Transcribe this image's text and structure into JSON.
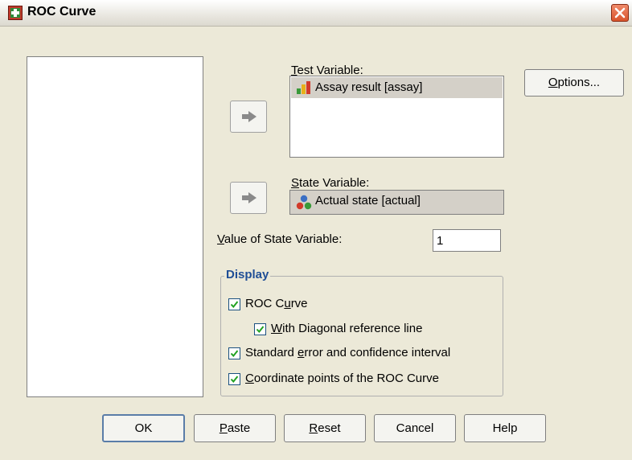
{
  "window": {
    "title": "ROC Curve"
  },
  "test_variable": {
    "label_accesskey": "T",
    "label_rest": "est Variable:",
    "item": "Assay result [assay]"
  },
  "state_variable": {
    "label_accesskey": "S",
    "label_rest": "tate Variable:",
    "item": "Actual state [actual]"
  },
  "value_of_state": {
    "label_accesskey": "V",
    "label_rest": "alue of State Variable:",
    "value": "1"
  },
  "options_button": {
    "accesskey": "O",
    "rest": "ptions..."
  },
  "display": {
    "legend": "Display",
    "roc_curve": {
      "before": "ROC C",
      "accesskey": "u",
      "after": "rve",
      "checked": true
    },
    "diagonal": {
      "before": "",
      "accesskey": "W",
      "after": "ith Diagonal reference line",
      "checked": true
    },
    "std_error": {
      "before": "Standard ",
      "accesskey": "e",
      "after": "rror and confidence interval",
      "checked": true
    },
    "coordinates": {
      "before": "",
      "accesskey": "C",
      "after": "oordinate points of the ROC Curve",
      "checked": true
    }
  },
  "buttons": {
    "ok": "OK",
    "paste": {
      "accesskey": "P",
      "rest": "aste"
    },
    "reset": {
      "accesskey": "R",
      "rest": "eset"
    },
    "cancel": "Cancel",
    "help": "Help"
  }
}
